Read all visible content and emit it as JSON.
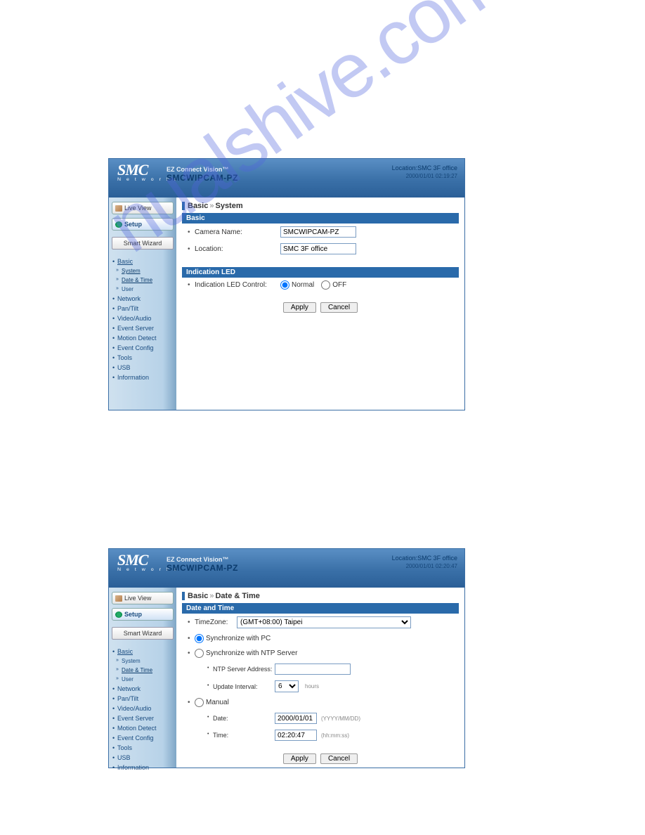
{
  "watermark": "nualshive.com",
  "header": {
    "logo_main": "SMC",
    "logo_sub": "N e t w o r k s",
    "product_line1": "EZ Connect Vision™",
    "product_line2": "SMCWIPCAM-PZ",
    "location_label": "Location:",
    "location_value": "SMC 3F office",
    "timestamp_top": "2000/01/01 02:19:27",
    "timestamp_bot": "2000/01/01 02:20:47"
  },
  "sidebar": {
    "live_view": "Live View",
    "setup": "Setup",
    "smart_wizard": "Smart Wizard",
    "nav": {
      "basic": "Basic",
      "system": "System",
      "date_time": "Date & Time",
      "user": "User",
      "network": "Network",
      "pantilt": "Pan/Tilt",
      "videoaudio": "Video/Audio",
      "eventserver": "Event Server",
      "motiondetect": "Motion Detect",
      "eventconfig": "Event Config",
      "tools": "Tools",
      "usb": "USB",
      "information": "Information"
    }
  },
  "panel1": {
    "bc_a": "Basic",
    "bc_b": "System",
    "sec_basic": "Basic",
    "camera_name_label": "Camera Name:",
    "camera_name_value": "SMCWIPCAM-PZ",
    "location_label": "Location:",
    "location_value": "SMC 3F office",
    "sec_led": "Indication LED",
    "led_control_label": "Indication LED Control:",
    "led_opt_normal": "Normal",
    "led_opt_off": "OFF",
    "apply": "Apply",
    "cancel": "Cancel"
  },
  "panel2": {
    "bc_a": "Basic",
    "bc_b": "Date & Time",
    "sec_dt": "Date and Time",
    "timezone_label": "TimeZone:",
    "timezone_value": "(GMT+08:00) Taipei",
    "sync_pc": "Synchronize with PC",
    "sync_ntp": "Synchronize with NTP Server",
    "ntp_addr_label": "NTP Server Address:",
    "ntp_addr_value": "",
    "update_int_label": "Update Interval:",
    "update_int_value": "6",
    "update_int_unit": "hours",
    "manual": "Manual",
    "date_label": "Date:",
    "date_value": "2000/01/01",
    "date_hint": "(YYYY/MM/DD)",
    "time_label": "Time:",
    "time_value": "02:20:47",
    "time_hint": "(hh:mm:ss)",
    "apply": "Apply",
    "cancel": "Cancel"
  }
}
